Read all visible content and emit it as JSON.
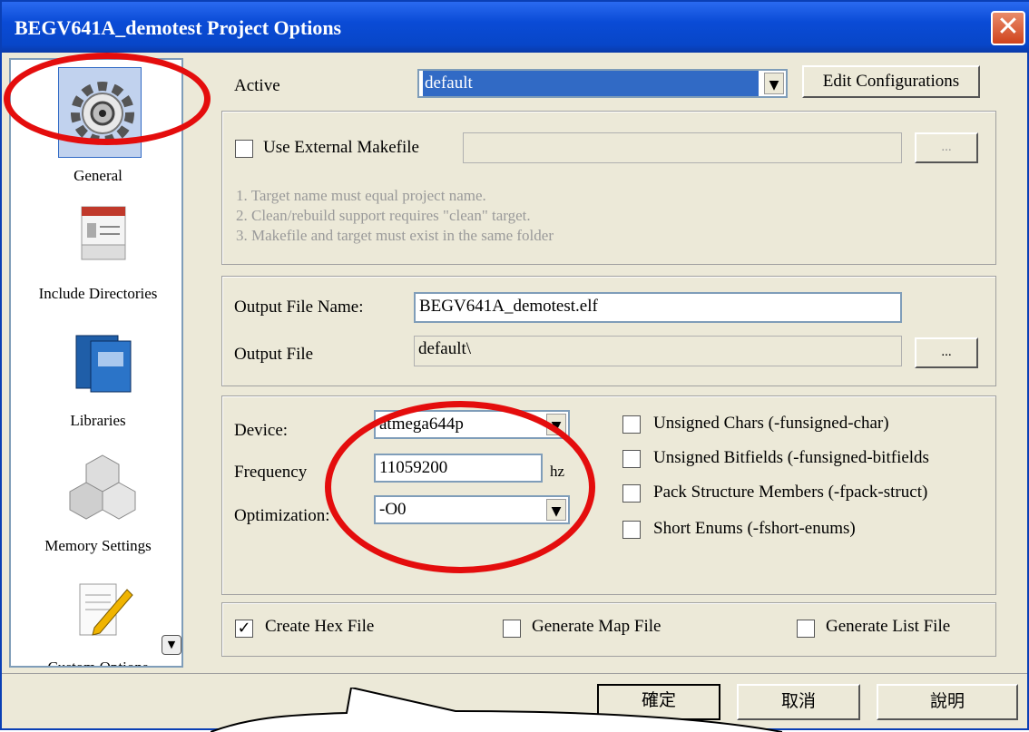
{
  "window": {
    "title": "BEGV641A_demotest Project Options",
    "close_glyph": "✕"
  },
  "sidebar": {
    "items": [
      {
        "label": "General",
        "icon": "gear-icon",
        "selected": true
      },
      {
        "label": "Include Directories",
        "icon": "folder-list-icon"
      },
      {
        "label": "Libraries",
        "icon": "books-icon"
      },
      {
        "label": "Memory Settings",
        "icon": "cubes-icon"
      },
      {
        "label": "Custom Options",
        "icon": "notepad-pencil-icon"
      }
    ],
    "scroll_glyph": "▼"
  },
  "active": {
    "label": "Active",
    "value": "default",
    "button": "Edit Configurations"
  },
  "makefile": {
    "checkbox_label": "Use External Makefile",
    "checked": false,
    "browse": "...",
    "notes": [
      "1. Target name must equal project name.",
      "2. Clean/rebuild support requires  \"clean\" target.",
      "3. Makefile and target must exist in the same folder"
    ]
  },
  "output": {
    "name_label": "Output File Name:",
    "name_value": "BEGV641A_demotest.elf",
    "dir_label": "Output File",
    "dir_value": "default\\",
    "browse": "..."
  },
  "device": {
    "device_label": "Device:",
    "device_value": "atmega644p",
    "freq_label": "Frequency",
    "freq_value": "11059200",
    "freq_unit": "hz",
    "opt_label": "Optimization:",
    "opt_value": "-O0"
  },
  "flags": [
    {
      "label": "Unsigned Chars (-funsigned-char)",
      "checked": false
    },
    {
      "label": "Unsigned Bitfields (-funsigned-bitfields",
      "checked": false
    },
    {
      "label": "Pack Structure Members (-fpack-struct)",
      "checked": false
    },
    {
      "label": "Short Enums (-fshort-enums)",
      "checked": false
    }
  ],
  "files": {
    "hex": {
      "label": "Create Hex File",
      "checked": true
    },
    "map": {
      "label": "Generate Map File",
      "checked": false
    },
    "list": {
      "label": "Generate List File",
      "checked": false
    }
  },
  "footer": {
    "ok": "確定",
    "cancel": "取消",
    "help": "說明"
  },
  "check_glyph": "✓",
  "dropdown_glyph": "▼",
  "annotation_color": "#e40d0d"
}
